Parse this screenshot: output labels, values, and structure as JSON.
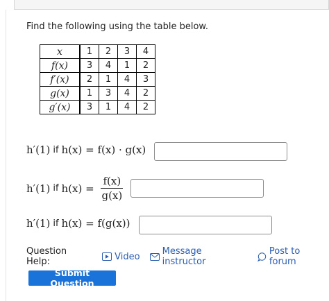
{
  "instructions": "Find the following using the table below.",
  "table": {
    "rows": [
      {
        "label": "x",
        "values": [
          "1",
          "2",
          "3",
          "4"
        ]
      },
      {
        "label": "f(x)",
        "values": [
          "3",
          "4",
          "1",
          "2"
        ]
      },
      {
        "label": "f′(x)",
        "values": [
          "2",
          "1",
          "4",
          "3"
        ]
      },
      {
        "label": "g(x)",
        "values": [
          "1",
          "3",
          "4",
          "2"
        ]
      },
      {
        "label": "g′(x)",
        "values": [
          "3",
          "1",
          "4",
          "2"
        ]
      }
    ]
  },
  "questions": [
    {
      "lhs": "h′(1)",
      "if_word": "if",
      "h": "h(x) = ",
      "rhs": "f(x) · g(x)",
      "answer": ""
    },
    {
      "lhs": "h′(1)",
      "if_word": "if",
      "h": "h(x) = ",
      "num": "f(x)",
      "den": "g(x)",
      "answer": ""
    },
    {
      "lhs": "h′(1)",
      "if_word": "if",
      "h": "h(x) = ",
      "rhs": "f(g(x))",
      "answer": ""
    }
  ],
  "help": {
    "label": "Question Help:",
    "video": "Video",
    "message": "Message instructor",
    "forum": "Post to forum"
  },
  "submit_label": "Submit Question"
}
